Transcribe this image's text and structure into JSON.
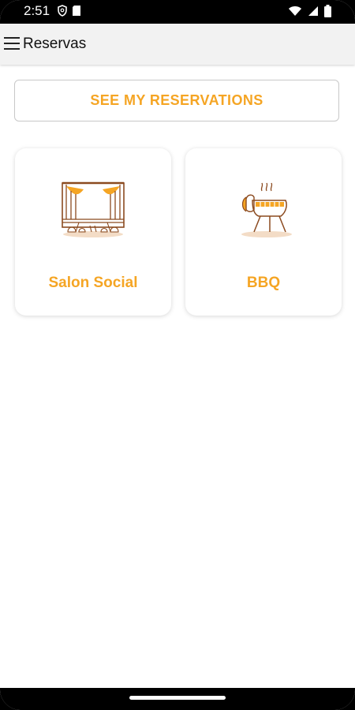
{
  "status_bar": {
    "time": "2:51",
    "left_icons": [
      "shield-icon",
      "sim-card-icon"
    ],
    "right_icons": [
      "wifi-icon",
      "signal-icon",
      "battery-icon"
    ]
  },
  "app_bar": {
    "menu_icon": "hamburger-menu-icon",
    "title": "Reservas"
  },
  "main": {
    "see_reservations_label": "SEE MY RESERVATIONS",
    "cards": [
      {
        "label": "Salon Social",
        "icon": "stage-icon"
      },
      {
        "label": "BBQ",
        "icon": "grill-icon"
      }
    ]
  },
  "colors": {
    "accent": "#f5a524",
    "icon_stroke": "#8b4a1f",
    "background": "#ffffff",
    "appbar": "#f2f2f2"
  }
}
